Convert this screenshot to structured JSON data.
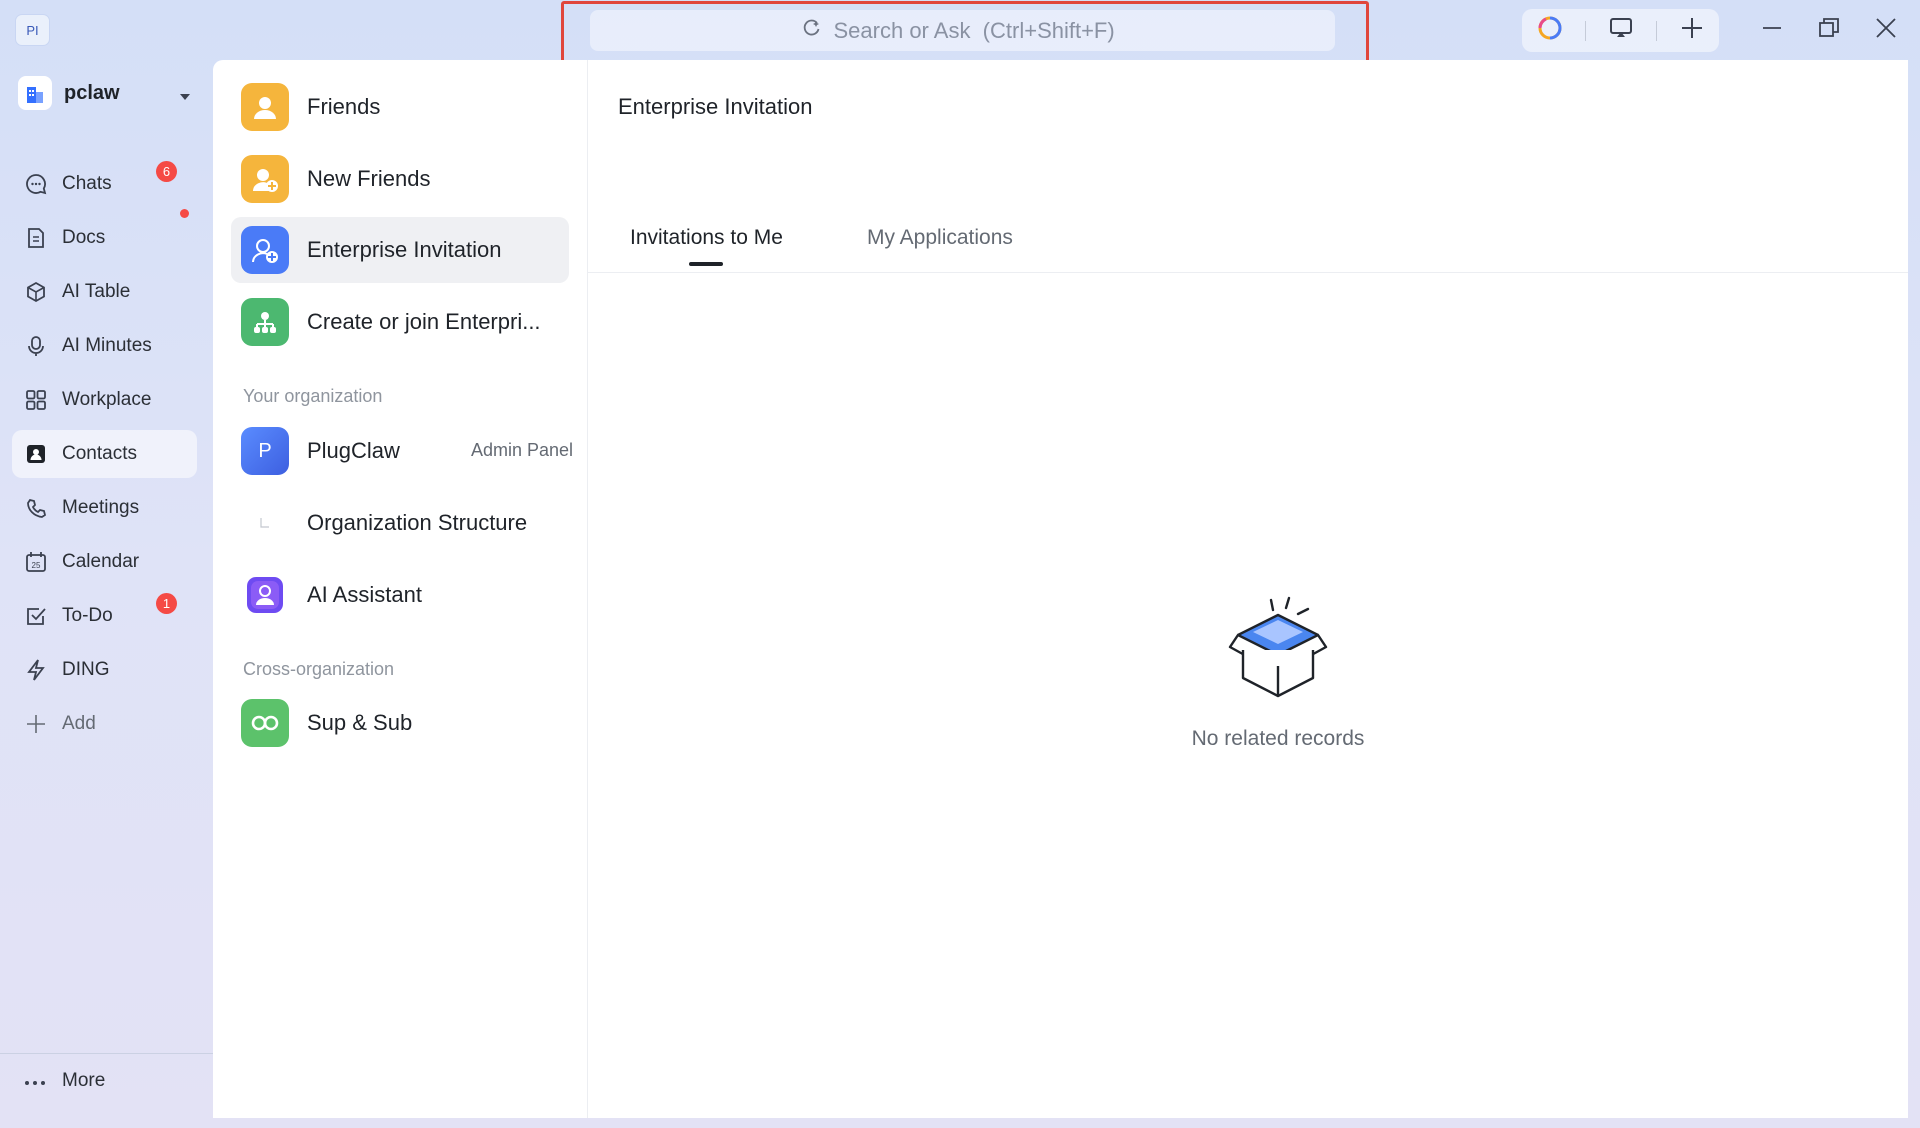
{
  "app": {
    "badge": "PI"
  },
  "search": {
    "placeholder": "Search or Ask  (Ctrl+Shift+F)"
  },
  "nav": {
    "org_name": "pclaw",
    "items": [
      {
        "label": "Chats",
        "icon": "chat-icon",
        "badge": "6"
      },
      {
        "label": "Docs",
        "icon": "docs-icon",
        "dot": true
      },
      {
        "label": "AI Table",
        "icon": "ai-table-icon"
      },
      {
        "label": "AI Minutes",
        "icon": "ai-minutes-icon"
      },
      {
        "label": "Workplace",
        "icon": "workplace-icon"
      },
      {
        "label": "Contacts",
        "icon": "contacts-icon",
        "active": true
      },
      {
        "label": "Meetings",
        "icon": "meetings-icon"
      },
      {
        "label": "Calendar",
        "icon": "calendar-icon"
      },
      {
        "label": "To-Do",
        "icon": "todo-icon",
        "badge": "1"
      },
      {
        "label": "DING",
        "icon": "ding-icon"
      },
      {
        "label": "Add",
        "icon": "plus-icon"
      }
    ],
    "more": "More"
  },
  "contacts_panel": {
    "items": [
      {
        "label": "Friends",
        "color": "#f5b53c"
      },
      {
        "label": "New Friends",
        "color": "#f5b53c"
      },
      {
        "label": "Enterprise Invitation",
        "color": "#4a7bf7",
        "active": true
      },
      {
        "label": "Create or join Enterpri...",
        "color": "#4cb870"
      }
    ],
    "your_org_heading": "Your organization",
    "org": {
      "initial": "P",
      "name": "PlugClaw",
      "admin": "Admin Panel"
    },
    "org_structure": "Organization Structure",
    "ai_assistant": "AI Assistant",
    "cross_org_heading": "Cross-organization",
    "sup_sub": "Sup & Sub"
  },
  "main": {
    "title": "Enterprise Invitation",
    "tabs": [
      "Invitations to Me",
      "My Applications"
    ],
    "active_tab": "Invitations to Me",
    "empty_text": "No related records"
  },
  "colors": {
    "accent": "#3370ff",
    "badge": "#f54a45",
    "highlight": "#e0463c"
  }
}
